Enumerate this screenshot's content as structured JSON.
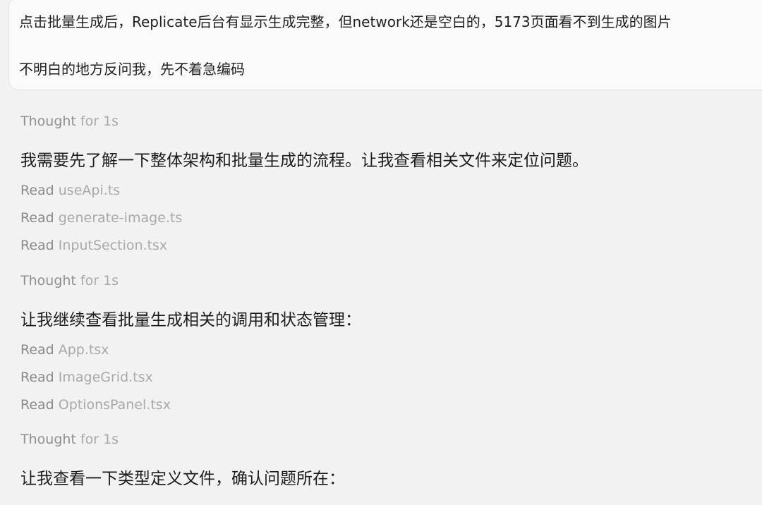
{
  "user_message": {
    "line1": "点击批量生成后，Replicate后台有显示生成完整，但network还是空白的，5173页面看不到生成的图片",
    "line2": "不明白的地方反问我，先不着急编码"
  },
  "steps": [
    {
      "thought": {
        "verb": "Thought",
        "duration": "for 1s"
      },
      "message": "我需要先了解一下整体架构和批量生成的流程。让我查看相关文件来定位问题。",
      "reads": [
        {
          "verb": "Read",
          "file": "useApi.ts"
        },
        {
          "verb": "Read",
          "file": "generate-image.ts"
        },
        {
          "verb": "Read",
          "file": "InputSection.tsx"
        }
      ]
    },
    {
      "thought": {
        "verb": "Thought",
        "duration": "for 1s"
      },
      "message": "让我继续查看批量生成相关的调用和状态管理：",
      "reads": [
        {
          "verb": "Read",
          "file": "App.tsx"
        },
        {
          "verb": "Read",
          "file": "ImageGrid.tsx"
        },
        {
          "verb": "Read",
          "file": "OptionsPanel.tsx"
        }
      ]
    },
    {
      "thought": {
        "verb": "Thought",
        "duration": "for 1s"
      },
      "message": "让我查看一下类型定义文件，确认问题所在："
    }
  ]
}
